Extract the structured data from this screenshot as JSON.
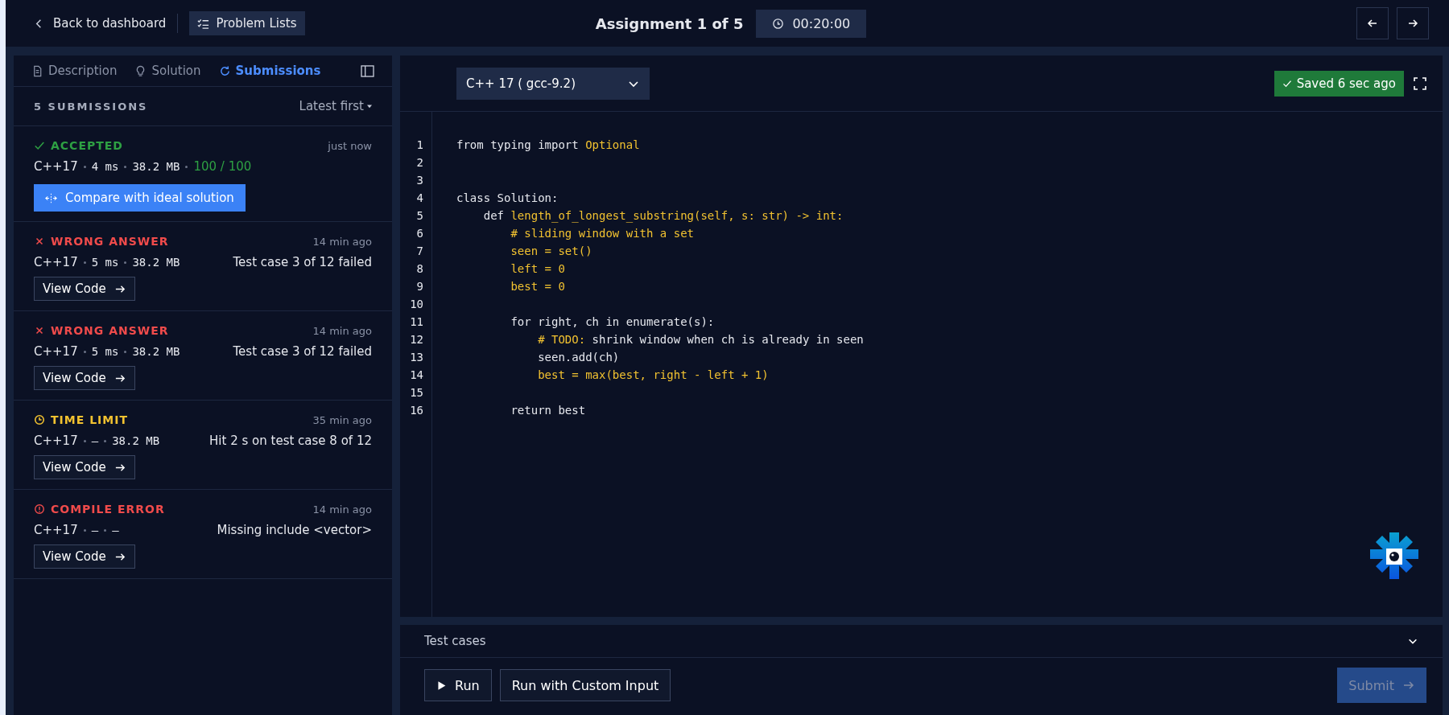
{
  "topbar": {
    "back_link": "Back to dashboard",
    "problem_lists": "Problem Lists",
    "title": "Assignment 1 of 5",
    "timer": "00:20:00"
  },
  "tabs": [
    {
      "label": "Description",
      "selected": false
    },
    {
      "label": "Solution",
      "selected": false
    },
    {
      "label": "Submissions",
      "selected": true
    }
  ],
  "submissions_header": {
    "count": "5 SUBMISSIONS",
    "sort": "Latest first"
  },
  "submissions": [
    {
      "kind": "accepted",
      "status": "ACCEPTED",
      "time": "just now",
      "meta": [
        "C++17",
        "4 ms",
        "38.2 MB"
      ],
      "score": "100 / 100",
      "action": "Compare with ideal solution"
    },
    {
      "kind": "wrong",
      "status": "WRONG ANSWER",
      "time": "14 min ago",
      "meta": [
        "C++17",
        "5 ms",
        "38.2 MB"
      ],
      "detail": "Test case 3 of 12 failed",
      "action": "View Code"
    },
    {
      "kind": "wrong",
      "status": "WRONG ANSWER",
      "time": "14 min ago",
      "meta": [
        "C++17",
        "5 ms",
        "38.2 MB"
      ],
      "detail": "Test case 3 of 12 failed",
      "action": "View Code"
    },
    {
      "kind": "time",
      "status": "TIME LIMIT",
      "time": "35 min ago",
      "meta": [
        "C++17",
        "—",
        "38.2 MB"
      ],
      "detail": "Hit 2 s on test case 8 of 12",
      "action": "View Code"
    },
    {
      "kind": "compile",
      "status": "COMPILE ERROR",
      "time": "14 min ago",
      "meta": [
        "C++17",
        "—",
        "—"
      ],
      "detail": "Missing include <vector>",
      "action": "View Code"
    }
  ],
  "editor": {
    "language": "C++ 17 ( gcc-9.2)",
    "saved": "Saved 6 sec ago",
    "lines": [
      {
        "number": "1",
        "segments": [
          {
            "text": "from typing import ",
            "kind": "plain"
          },
          {
            "text": "Optional",
            "kind": "accent"
          }
        ]
      },
      {
        "number": "2"
      },
      {
        "number": "3"
      },
      {
        "number": "4",
        "segments": [
          {
            "text": "class Solution:",
            "kind": "plain"
          }
        ]
      },
      {
        "number": "5",
        "segments": [
          {
            "text": "    def ",
            "kind": "plain"
          },
          {
            "text": "length_of_longest_substring(self, s: str) -> int:",
            "kind": "accent"
          }
        ]
      },
      {
        "number": "6",
        "segments": [
          {
            "text": "        # sliding window with a set",
            "kind": "accent"
          }
        ]
      },
      {
        "number": "7",
        "segments": [
          {
            "text": "        seen = set()",
            "kind": "accent"
          }
        ]
      },
      {
        "number": "8",
        "segments": [
          {
            "text": "        left = 0",
            "kind": "accent"
          }
        ]
      },
      {
        "number": "9",
        "segments": [
          {
            "text": "        best = 0",
            "kind": "accent"
          }
        ]
      },
      {
        "number": "10"
      },
      {
        "number": "11",
        "segments": [
          {
            "text": "        for right, ch in enumerate(s):",
            "kind": "plain"
          }
        ]
      },
      {
        "number": "12",
        "segments": [
          {
            "text": "            # TODO:",
            "kind": "accent"
          },
          {
            "text": " shrink window when ch is already in seen",
            "kind": "plain"
          }
        ]
      },
      {
        "number": "13",
        "segments": [
          {
            "text": "            seen.add(ch)",
            "kind": "plain"
          }
        ]
      },
      {
        "number": "14",
        "segments": [
          {
            "text": "            best = max(best, right - left + 1)",
            "kind": "accent"
          }
        ]
      },
      {
        "number": "15"
      },
      {
        "number": "16",
        "segments": [
          {
            "text": "        return best",
            "kind": "plain"
          }
        ]
      }
    ]
  },
  "test_panel": {
    "title": "Test cases",
    "run": "Run",
    "custom": "Run with Custom Input",
    "submit": {
      "label": "Submit",
      "disabled": true
    }
  }
}
